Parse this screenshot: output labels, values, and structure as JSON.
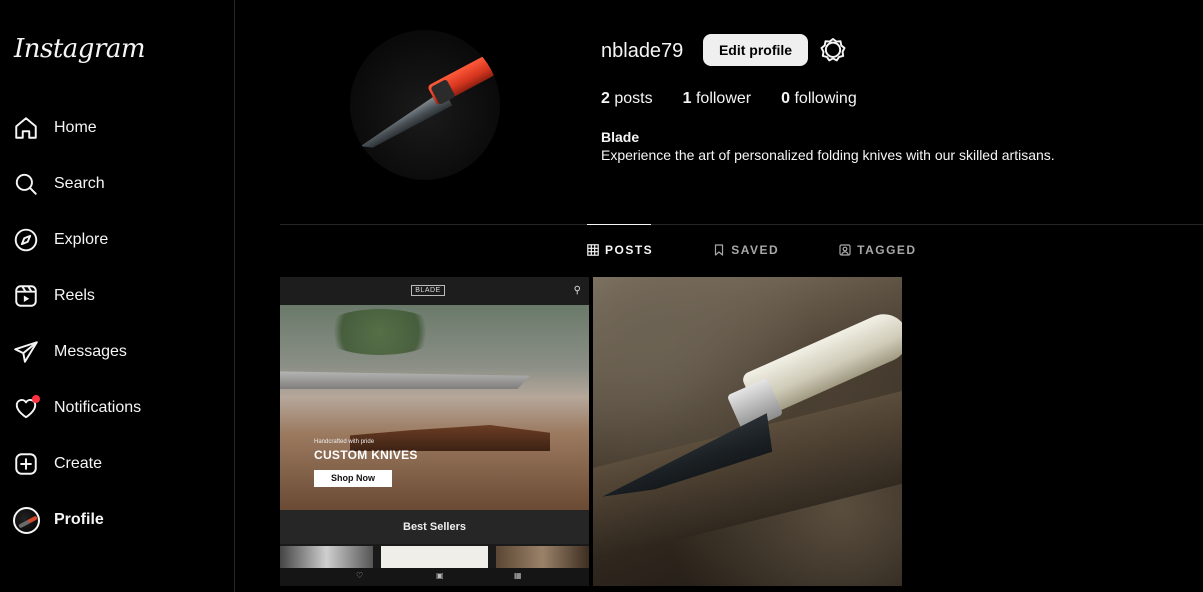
{
  "brand": {
    "logo_text": "Instagram"
  },
  "sidebar": {
    "items": [
      {
        "label": "Home",
        "icon": "home-icon"
      },
      {
        "label": "Search",
        "icon": "search-icon"
      },
      {
        "label": "Explore",
        "icon": "compass-icon"
      },
      {
        "label": "Reels",
        "icon": "reels-icon"
      },
      {
        "label": "Messages",
        "icon": "send-icon"
      },
      {
        "label": "Notifications",
        "icon": "heart-icon",
        "badge": true
      },
      {
        "label": "Create",
        "icon": "plus-square-icon"
      },
      {
        "label": "Profile",
        "icon": "avatar",
        "active": true
      }
    ]
  },
  "profile": {
    "username": "nblade79",
    "edit_label": "Edit profile",
    "stats": [
      {
        "count": "2",
        "label": "posts"
      },
      {
        "count": "1",
        "label": "follower"
      },
      {
        "count": "0",
        "label": "following"
      }
    ],
    "bio_name": "Blade",
    "bio_text": "Experience the art of personalized folding knives with our skilled artisans."
  },
  "tabs": [
    {
      "label": "POSTS",
      "icon": "grid-icon",
      "active": true
    },
    {
      "label": "SAVED",
      "icon": "bookmark-icon",
      "active": false
    },
    {
      "label": "TAGGED",
      "icon": "tagged-icon",
      "active": false
    }
  ],
  "posts": [
    {
      "logo": "BLADE",
      "tagline": "Handcrafted with pride",
      "headline": "CUSTOM KNIVES",
      "cta": "Shop Now",
      "section": "Best Sellers"
    },
    {}
  ],
  "colors": {
    "background": "#000000",
    "text": "#f5f5f5",
    "muted": "#a8a8a8",
    "notification": "#ff3040",
    "button": "#efefef",
    "border": "#262626"
  }
}
